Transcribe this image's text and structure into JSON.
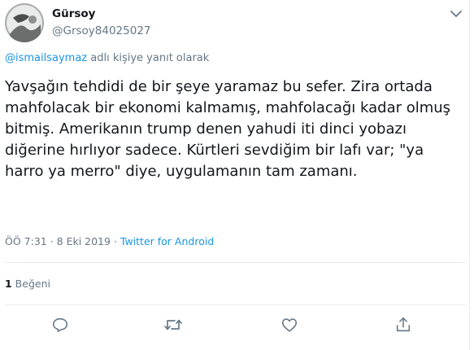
{
  "tweet": {
    "author_name": "Gürsoy",
    "author_handle": "@Grsoy84025027",
    "reply_mention": "@ismailsaymaz",
    "reply_suffix": " adlı kişiye yanıt olarak",
    "text": "Yavşağın tehdidi de bir şeye yaramaz bu sefer. Zira ortada mahfolacak bir ekonomi kalmamış, mahfolacağı kadar olmuş bitmiş. Amerikanın trump denen yahudi iti dinci yobazı diğerine hırlıyor sadece. Kürtleri sevdiğim bir lafı var; \"ya harro ya merro\" diye, uygulamanın tam zamanı.",
    "timestamp": "ÖÖ 7:31 · 8 Eki 2019",
    "separator": " · ",
    "source": "Twitter for Android",
    "like_count": "1",
    "like_label": " Beğeni"
  },
  "actions": [
    {
      "icon": "reply-icon"
    },
    {
      "icon": "retweet-icon"
    },
    {
      "icon": "like-icon"
    },
    {
      "icon": "share-icon"
    }
  ],
  "colors": {
    "accent": "#1b95e0",
    "secondary_text": "#657786",
    "primary_text": "#14171a",
    "divider": "#e6ecf0"
  }
}
